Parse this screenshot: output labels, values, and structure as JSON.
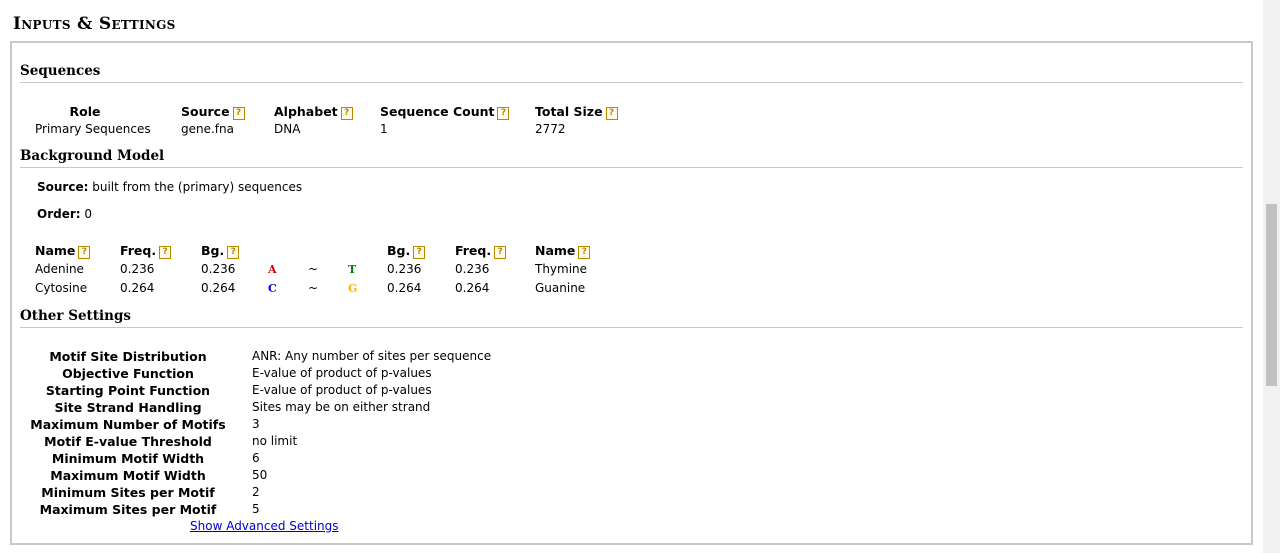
{
  "title": "Inputs & Settings",
  "sequences": {
    "heading": "Sequences",
    "columns": [
      "Role",
      "Source",
      "Alphabet",
      "Sequence Count",
      "Total Size"
    ],
    "row": [
      "Primary Sequences",
      "gene.fna",
      "DNA",
      "1",
      "2772"
    ]
  },
  "background": {
    "heading": "Background Model",
    "source_label": "Source:",
    "source_value": "built from the (primary) sequences",
    "order_label": "Order:",
    "order_value": "0",
    "columns": [
      "Name",
      "Freq.",
      "Bg.",
      "Bg.",
      "Freq.",
      "Name"
    ],
    "rows": [
      {
        "left_name": "Adenine",
        "left_freq": "0.236",
        "left_bg": "0.236",
        "left_base": "A",
        "sep": "~",
        "right_base": "T",
        "right_bg": "0.236",
        "right_freq": "0.236",
        "right_name": "Thymine"
      },
      {
        "left_name": "Cytosine",
        "left_freq": "0.264",
        "left_bg": "0.264",
        "left_base": "C",
        "sep": "~",
        "right_base": "G",
        "right_bg": "0.264",
        "right_freq": "0.264",
        "right_name": "Guanine"
      }
    ],
    "base_colors": {
      "A": "#cc0000",
      "T": "#008000",
      "C": "#0000cc",
      "G": "#ffb300"
    }
  },
  "other": {
    "heading": "Other Settings",
    "settings": [
      {
        "label": "Motif Site Distribution",
        "value": "ANR: Any number of sites per sequence"
      },
      {
        "label": "Objective Function",
        "value": "E-value of product of p-values"
      },
      {
        "label": "Starting Point Function",
        "value": "E-value of product of p-values"
      },
      {
        "label": "Site Strand Handling",
        "value": "Sites may be on either strand"
      },
      {
        "label": "Maximum Number of Motifs",
        "value": "3"
      },
      {
        "label": "Motif E-value Threshold",
        "value": "no limit"
      },
      {
        "label": "Minimum Motif Width",
        "value": "6"
      },
      {
        "label": "Maximum Motif Width",
        "value": "50"
      },
      {
        "label": "Minimum Sites per Motif",
        "value": "2"
      },
      {
        "label": "Maximum Sites per Motif",
        "value": "5"
      }
    ],
    "advanced_link": "Show Advanced Settings"
  },
  "help_glyph": "?"
}
